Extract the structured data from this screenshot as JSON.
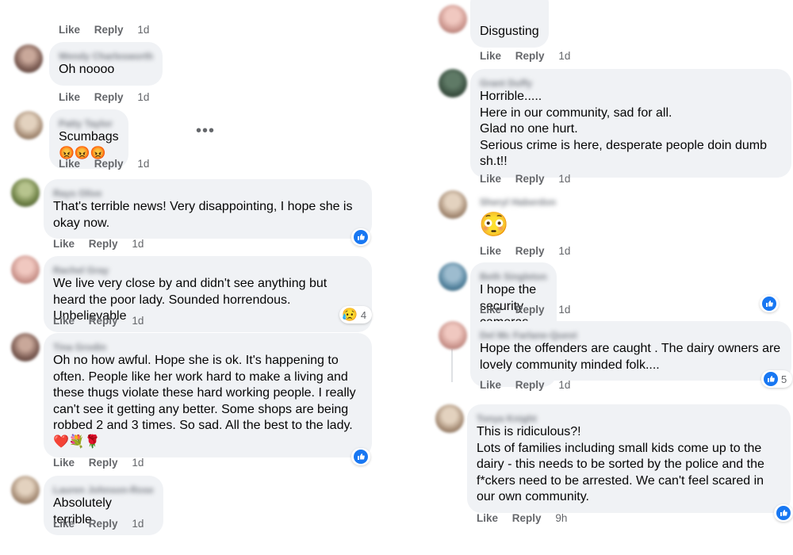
{
  "actions": {
    "like": "Like",
    "reply": "Reply"
  },
  "left_column": {
    "top_actions_time": "1d",
    "comments": [
      {
        "name": "Wendy Charlesworth",
        "text": "Oh noooo",
        "time": "1d"
      },
      {
        "name": "Patty Taylor",
        "text": "Scumbags 😡😡😡",
        "time": "1d",
        "more": "•••"
      },
      {
        "name": "Rays Olive",
        "text": "That's terrible news! Very disappointing, I hope she is okay now.",
        "time": "1d",
        "reaction_count": ""
      },
      {
        "name": "Rachel Gray",
        "text": "We live very close by and didn't see anything but heard the poor lady. Sounded horrendous. Unbelievable",
        "time": "1d",
        "reaction_emoji": "😥",
        "reaction_count": "4"
      },
      {
        "name": "Tina Grodin",
        "text": "Oh no how awful. Hope she is ok. It's happening to often. People like her work hard to make a living and these thugs violate these hard working people. I really can't see it getting any better. Some shops are being robbed 2 and 3 times. So sad. All the best to the lady. ❤️💐🌹",
        "time": "1d"
      },
      {
        "name": "Lauren Johnson-Rose",
        "text": "Absolutely terrible",
        "time": "1d"
      }
    ]
  },
  "right_column": {
    "comments": [
      {
        "name": "Jade Mayes",
        "text": "Disgusting",
        "time": "1d"
      },
      {
        "name": "Grant Duffy",
        "text": "Horrible.....\nHere in our community, sad for all.\nGlad no one hurt.\nSerious crime is here, desperate people doin dumb sh.t!!",
        "time": "1d"
      },
      {
        "name": "Sheryl Haberdon",
        "text": "😳",
        "time": "1d"
      },
      {
        "name": "Beth Singleton",
        "text": "I hope the security cameras got a good look at them!!",
        "time": "1d"
      },
      {
        "name": "Del Mc Farlane-Quest",
        "text": "Hope the offenders are caught . The dairy owners are lovely community minded folk....",
        "time": "1d",
        "reaction_count": "5"
      },
      {
        "name": "Tonya Knight",
        "text": "This is ridiculous?!\nLots of families including small kids come up to the dairy - this needs to be sorted by the police and the f*ckers need to be arrested. We can't feel scared in our own community.",
        "time": "9h"
      }
    ]
  },
  "colors": {
    "bubble": "#f0f2f5",
    "like_blue": "#1877f2",
    "action_gray": "#65676b"
  }
}
